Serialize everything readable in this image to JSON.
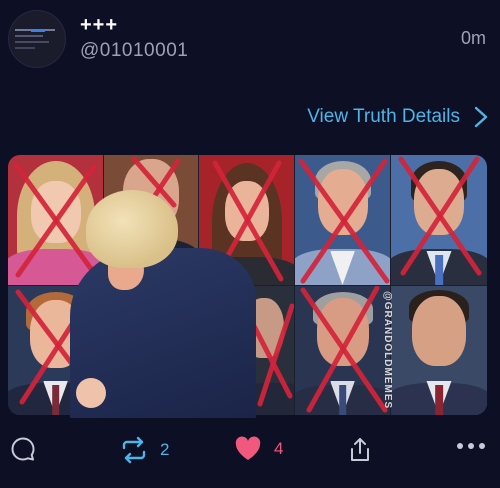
{
  "post": {
    "display_name": "+++",
    "handle": "@01010001",
    "timestamp": "0m",
    "view_details_label": "View Truth Details",
    "image": {
      "watermark": "@GRANDOLDMEMES"
    },
    "actions": {
      "reply_count": "",
      "retruth_count": "2",
      "like_count": "4"
    }
  },
  "colors": {
    "background": "#0d0f24",
    "link": "#4fb4e6",
    "retruth_active": "#4fb4e6",
    "like_active": "#f0587e",
    "muted_text": "#9da1b8",
    "cross_mark": "#d3243a"
  },
  "icons": {
    "reply": "speech-bubble-icon",
    "retruth": "retruth-arrows-icon",
    "like": "heart-icon",
    "share": "share-upload-icon",
    "more": "ellipsis-icon",
    "details": "chevron-right-icon"
  }
}
